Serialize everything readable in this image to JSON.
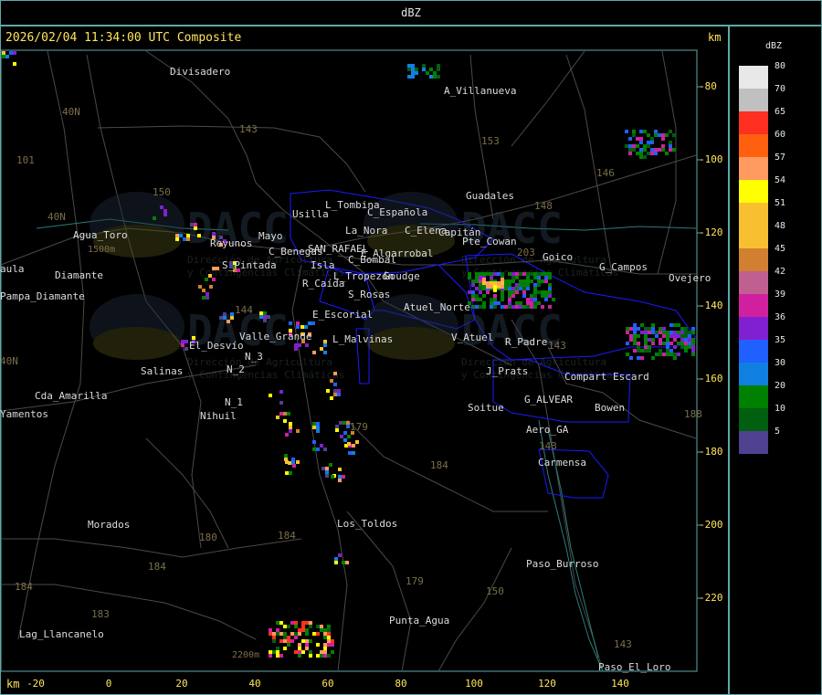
{
  "title": "dBZ",
  "timestamp": "2026/02/04 11:34:00 UTC Composite",
  "axis_unit": "km",
  "y_ticks": [
    "-80",
    "-100",
    "-120",
    "-140",
    "-160",
    "-180",
    "-200",
    "-220"
  ],
  "x_ticks": [
    "-20",
    "0",
    "20",
    "40",
    "60",
    "80",
    "100",
    "120",
    "140"
  ],
  "legend": {
    "title": "dBZ",
    "levels": [
      {
        "label": "80",
        "color": "#e8e8e8"
      },
      {
        "label": "70",
        "color": "#c0c0c0"
      },
      {
        "label": "65",
        "color": "#ff3020"
      },
      {
        "label": "60",
        "color": "#ff6010"
      },
      {
        "label": "57",
        "color": "#ff9a60"
      },
      {
        "label": "54",
        "color": "#ffff00"
      },
      {
        "label": "51",
        "color": "#f8c030"
      },
      {
        "label": "48",
        "color": "#f8c030"
      },
      {
        "label": "45",
        "color": "#d08030"
      },
      {
        "label": "42",
        "color": "#c06090"
      },
      {
        "label": "39",
        "color": "#d020a0"
      },
      {
        "label": "36",
        "color": "#8020d0"
      },
      {
        "label": "35",
        "color": "#2060ff"
      },
      {
        "label": "30",
        "color": "#1080e0"
      },
      {
        "label": "20",
        "color": "#008000"
      },
      {
        "label": "10",
        "color": "#006010"
      },
      {
        "label": "5",
        "color": "#504090"
      }
    ]
  },
  "watermark": {
    "brand": "DACC",
    "line1": "Dirección de Agricultura",
    "line2": "y Contingencias Climáticas"
  },
  "places": [
    {
      "name": "Divisadero"
    },
    {
      "name": "A_Villanueva"
    },
    {
      "name": "Agua_Toro"
    },
    {
      "name": "Reyunos"
    },
    {
      "name": "Mayo"
    },
    {
      "name": "Usilla"
    },
    {
      "name": "L_Tombina"
    },
    {
      "name": "La_Nora"
    },
    {
      "name": "C_Española"
    },
    {
      "name": "C_Elena"
    },
    {
      "name": "Capitán"
    },
    {
      "name": "Pte_Cowan"
    },
    {
      "name": "Guadales"
    },
    {
      "name": "Goico"
    },
    {
      "name": "G_Campos"
    },
    {
      "name": "Ovejero"
    },
    {
      "name": "C_Benegas"
    },
    {
      "name": "SAN_RAFAEL"
    },
    {
      "name": "E_Algarrobal"
    },
    {
      "name": "C_Bombal"
    },
    {
      "name": "Isla"
    },
    {
      "name": "S_Pintada"
    },
    {
      "name": "L_Tropezón"
    },
    {
      "name": "Goudge"
    },
    {
      "name": "R_Caída"
    },
    {
      "name": "S_Rosas"
    },
    {
      "name": "Atuel_Norte"
    },
    {
      "name": "Pampa_Diamante"
    },
    {
      "name": "E_Escorial"
    },
    {
      "name": "Valle_Grande"
    },
    {
      "name": "L_Malvinas"
    },
    {
      "name": "V_Atuel"
    },
    {
      "name": "R_Padre"
    },
    {
      "name": "El_Desvío"
    },
    {
      "name": "Salinas"
    },
    {
      "name": "N_2"
    },
    {
      "name": "N_3"
    },
    {
      "name": "N_1"
    },
    {
      "name": "J_Prats"
    },
    {
      "name": "Compart Escard"
    },
    {
      "name": "G_ALVEAR"
    },
    {
      "name": "Soitue"
    },
    {
      "name": "Bowen"
    },
    {
      "name": "Cda_Amarilla"
    },
    {
      "name": "Nihuil"
    },
    {
      "name": "Aero_GA"
    },
    {
      "name": "Carmensa"
    },
    {
      "name": "Morados"
    },
    {
      "name": "Los_Toldos"
    },
    {
      "name": "Paso_Burroso"
    },
    {
      "name": "Punta_Agua"
    },
    {
      "name": "Lag_Llancanelo"
    },
    {
      "name": "Paso_El_Loro"
    },
    {
      "name": "Diamante"
    },
    {
      "name": "Yamentos"
    },
    {
      "name": "aula"
    }
  ],
  "elevation_labels": [
    "1500m",
    "2200m"
  ],
  "road_numbers": [
    "40N",
    "40N",
    "101",
    "143",
    "153",
    "150",
    "146",
    "148",
    "203",
    "144",
    "143",
    "179",
    "184",
    "180",
    "184",
    "184",
    "183",
    "179",
    "150",
    "143",
    "184",
    "143",
    "188",
    "40N"
  ]
}
